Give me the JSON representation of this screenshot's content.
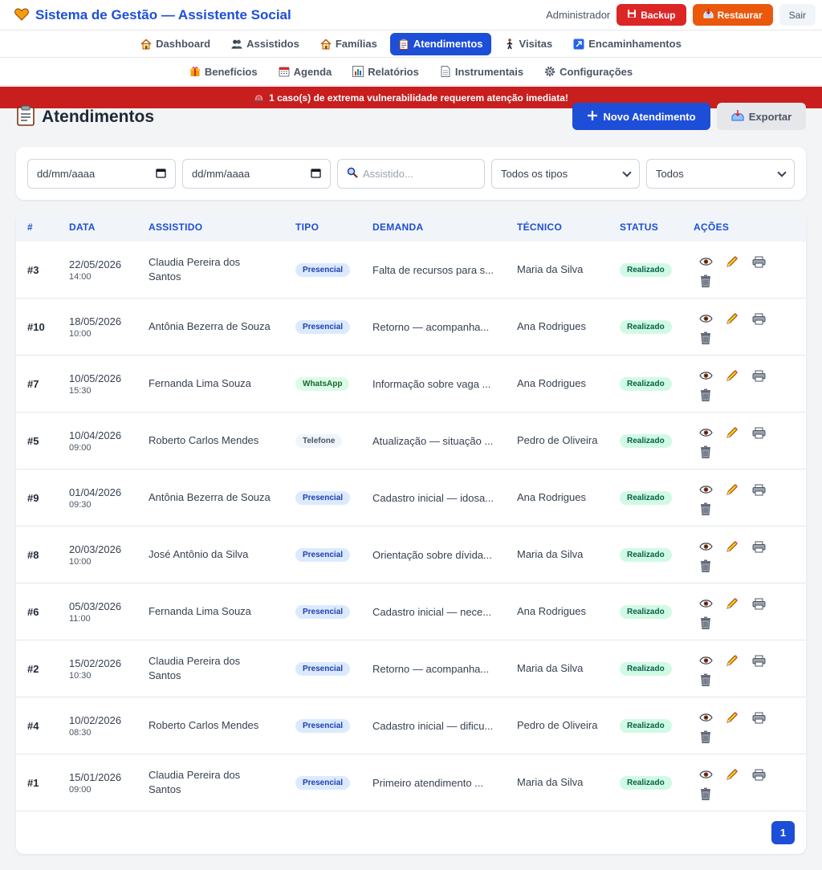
{
  "header": {
    "title": "Sistema de Gestão — Assistente Social",
    "user": "Administrador",
    "backup_label": "Backup",
    "restore_label": "Restaurar",
    "logout_label": "Sair"
  },
  "nav": {
    "primary": [
      {
        "label": "Dashboard",
        "icon": "house-icon"
      },
      {
        "label": "Assistidos",
        "icon": "users-icon"
      },
      {
        "label": "Famílias",
        "icon": "house-icon"
      },
      {
        "label": "Atendimentos",
        "icon": "clipboard-icon",
        "active": true
      },
      {
        "label": "Visitas",
        "icon": "walking-icon"
      },
      {
        "label": "Encaminhamentos",
        "icon": "arrow-up-right-icon"
      }
    ],
    "secondary": [
      {
        "label": "Benefícios",
        "icon": "gift-icon"
      },
      {
        "label": "Agenda",
        "icon": "calendar-icon"
      },
      {
        "label": "Relatórios",
        "icon": "chart-icon"
      },
      {
        "label": "Instrumentais",
        "icon": "document-icon"
      },
      {
        "label": "Configurações",
        "icon": "gear-icon"
      }
    ]
  },
  "alert": {
    "text": "1 caso(s) de extrema vulnerabilidade requerem atenção imediata!"
  },
  "page": {
    "title": "Atendimentos",
    "new_label": "Novo Atendimento",
    "export_label": "Exportar"
  },
  "filters": {
    "date_from": "dd/mm/aaaa",
    "date_to": "dd/mm/aaaa",
    "search_placeholder": "Assistido...",
    "type_select": "Todos os tipos",
    "status_select": "Todos"
  },
  "table": {
    "headers": [
      "#",
      "DATA",
      "ASSISTIDO",
      "TIPO",
      "DEMANDA",
      "TÉCNICO",
      "STATUS",
      "AÇÕES"
    ],
    "rows": [
      {
        "id": "#3",
        "date": "22/05/2026",
        "time": "14:00",
        "name": "Claudia Pereira dos Santos",
        "type": "Presencial",
        "demand": "Falta de recursos para s...",
        "tech": "Maria da Silva",
        "status": "Realizado"
      },
      {
        "id": "#10",
        "date": "18/05/2026",
        "time": "10:00",
        "name": "Antônia Bezerra de Souza",
        "type": "Presencial",
        "demand": "Retorno — acompanha...",
        "tech": "Ana Rodrigues",
        "status": "Realizado"
      },
      {
        "id": "#7",
        "date": "10/05/2026",
        "time": "15:30",
        "name": "Fernanda Lima Souza",
        "type": "WhatsApp",
        "demand": "Informação sobre vaga ...",
        "tech": "Ana Rodrigues",
        "status": "Realizado"
      },
      {
        "id": "#5",
        "date": "10/04/2026",
        "time": "09:00",
        "name": "Roberto Carlos Mendes",
        "type": "Telefone",
        "demand": "Atualização — situação ...",
        "tech": "Pedro de Oliveira",
        "status": "Realizado"
      },
      {
        "id": "#9",
        "date": "01/04/2026",
        "time": "09:30",
        "name": "Antônia Bezerra de Souza",
        "type": "Presencial",
        "demand": "Cadastro inicial — idosa...",
        "tech": "Ana Rodrigues",
        "status": "Realizado"
      },
      {
        "id": "#8",
        "date": "20/03/2026",
        "time": "10:00",
        "name": "José Antônio da Silva",
        "type": "Presencial",
        "demand": "Orientação sobre dívida...",
        "tech": "Maria da Silva",
        "status": "Realizado"
      },
      {
        "id": "#6",
        "date": "05/03/2026",
        "time": "11:00",
        "name": "Fernanda Lima Souza",
        "type": "Presencial",
        "demand": "Cadastro inicial — nece...",
        "tech": "Ana Rodrigues",
        "status": "Realizado"
      },
      {
        "id": "#2",
        "date": "15/02/2026",
        "time": "10:30",
        "name": "Claudia Pereira dos Santos",
        "type": "Presencial",
        "demand": "Retorno — acompanha...",
        "tech": "Maria da Silva",
        "status": "Realizado"
      },
      {
        "id": "#4",
        "date": "10/02/2026",
        "time": "08:30",
        "name": "Roberto Carlos Mendes",
        "type": "Presencial",
        "demand": "Cadastro inicial — dificu...",
        "tech": "Pedro de Oliveira",
        "status": "Realizado"
      },
      {
        "id": "#1",
        "date": "15/01/2026",
        "time": "09:00",
        "name": "Claudia Pereira dos Santos",
        "type": "Presencial",
        "demand": "Primeiro atendimento ...",
        "tech": "Maria da Silva",
        "status": "Realizado"
      }
    ]
  },
  "pagination": {
    "current": "1"
  },
  "colors": {
    "primary": "#1d4ed8",
    "danger": "#dc2626",
    "warning": "#ea580c",
    "alert": "#c81e1e"
  }
}
